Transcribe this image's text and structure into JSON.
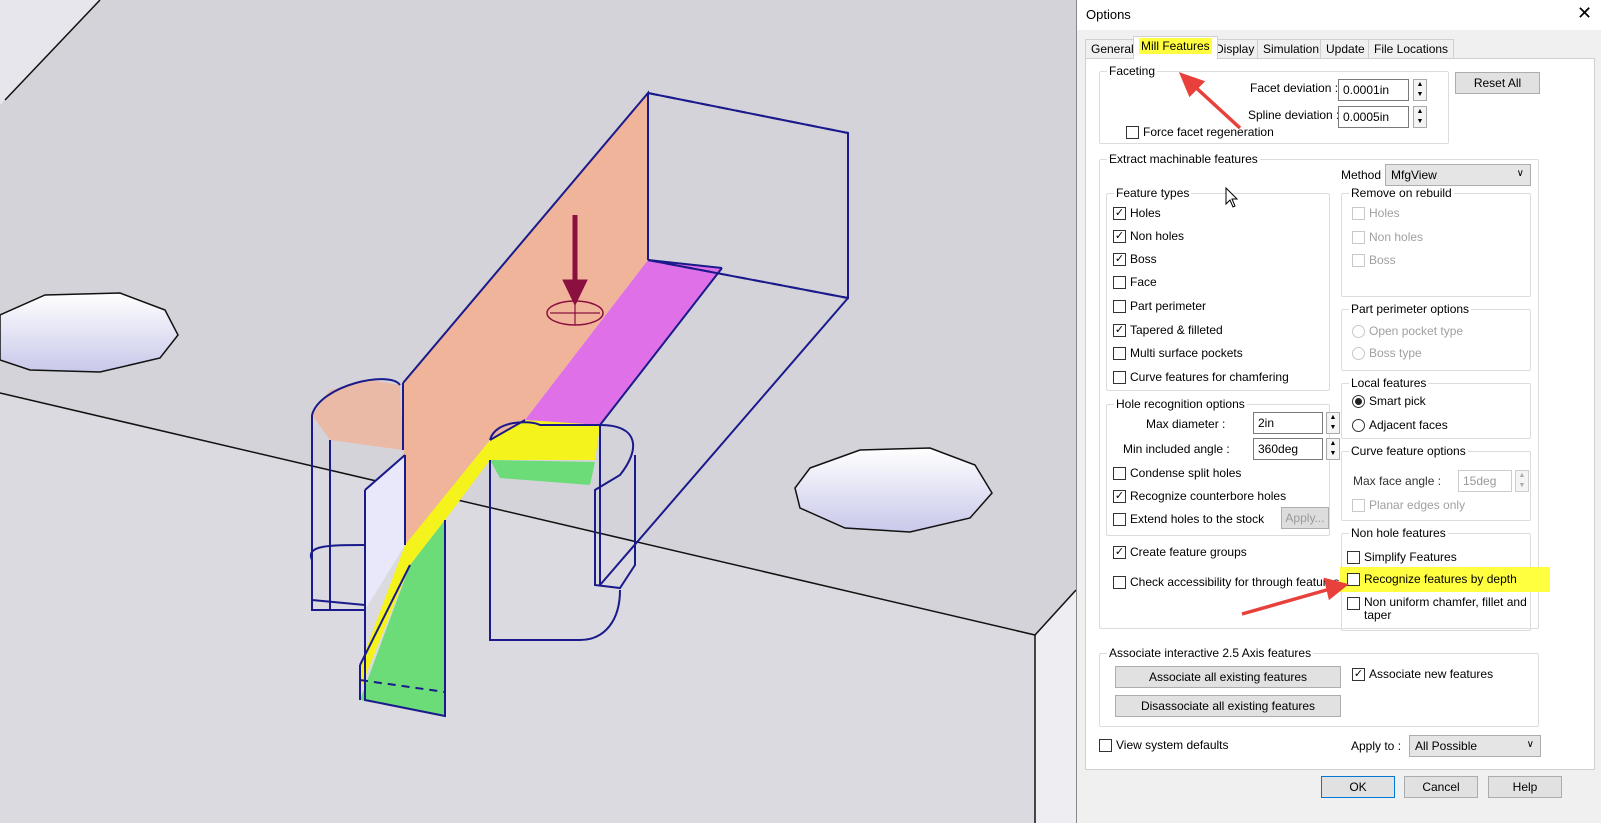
{
  "dialog": {
    "title": "Options",
    "close_icon": "close-icon",
    "tabs": [
      {
        "label": "General"
      },
      {
        "label": "Mill Features",
        "active": true
      },
      {
        "label": "Display"
      },
      {
        "label": "Simulation"
      },
      {
        "label": "Update"
      },
      {
        "label": "File Locations"
      }
    ],
    "faceting": {
      "label": "Faceting",
      "facet_deviation_label": "Facet deviation :",
      "facet_deviation": "0.0001in",
      "spline_deviation_label": "Spline deviation :",
      "spline_deviation": "0.0005in",
      "force_regen": "Force facet regeneration",
      "force_regen_checked": false
    },
    "reset_all": "Reset All",
    "extract": {
      "label": "Extract machinable features",
      "method_label": "Method :",
      "method": "MfgView",
      "feature_types": {
        "label": "Feature types",
        "items": [
          {
            "label": "Holes",
            "checked": true
          },
          {
            "label": "Non holes",
            "checked": true
          },
          {
            "label": "Boss",
            "checked": true
          },
          {
            "label": "Face",
            "checked": false
          },
          {
            "label": "Part perimeter",
            "checked": false
          },
          {
            "label": "Tapered & filleted",
            "checked": true
          },
          {
            "label": "Multi surface pockets",
            "checked": false
          },
          {
            "label": "Curve features for chamfering",
            "checked": false
          }
        ]
      },
      "remove_on_rebuild": {
        "label": "Remove on rebuild",
        "items": [
          {
            "label": "Holes"
          },
          {
            "label": "Non holes"
          },
          {
            "label": "Boss"
          }
        ]
      },
      "part_perimeter": {
        "label": "Part perimeter options",
        "items": [
          {
            "label": "Open pocket type"
          },
          {
            "label": "Boss type"
          }
        ]
      },
      "local_features": {
        "label": "Local features",
        "items": [
          {
            "label": "Smart pick",
            "selected": true
          },
          {
            "label": "Adjacent faces",
            "selected": false
          }
        ]
      },
      "hole_recognition": {
        "label": "Hole recognition options",
        "max_diameter_label": "Max diameter :",
        "max_diameter": "2in",
        "min_angle_label": "Min included angle :",
        "min_angle": "360deg",
        "condense": "Condense split holes",
        "counterbore": "Recognize counterbore holes",
        "extend": "Extend holes to the stock",
        "apply": "Apply..."
      },
      "curve_feature": {
        "label": "Curve feature options",
        "max_face_angle_label": "Max face angle :",
        "max_face_angle": "15deg",
        "planar_edges": "Planar edges only"
      },
      "create_groups": "Create feature groups",
      "check_access": "Check accessibility for through features",
      "non_hole": {
        "label": "Non hole features",
        "simplify": "Simplify Features",
        "by_depth": "Recognize features by depth",
        "non_uniform": "Non uniform chamfer, fillet and taper"
      }
    },
    "associate": {
      "label": "Associate interactive 2.5 Axis features",
      "assoc_all": "Associate all existing features",
      "disassoc_all": "Disassociate all existing features",
      "assoc_new": "Associate new features",
      "assoc_new_checked": true
    },
    "view_defaults": "View system defaults",
    "apply_to_label": "Apply to :",
    "apply_to": "All Possible",
    "ok": "OK",
    "cancel": "Cancel",
    "help": "Help"
  },
  "colors": {
    "highlight": "#ffff40",
    "arrow": "#e8403a",
    "wire": "#1a1a8c",
    "salmon": "#f0b49a",
    "magenta": "#e070e8",
    "yellow": "#f4f41c",
    "green": "#6cdc78"
  }
}
